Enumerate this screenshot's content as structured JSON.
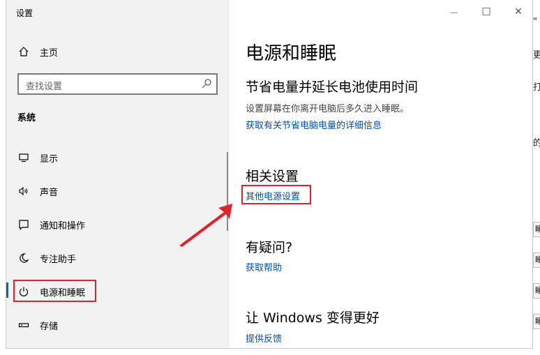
{
  "window": {
    "title": "设置"
  },
  "caption": {
    "minimize": "—",
    "maximize": "☐",
    "close": "✕"
  },
  "sidebar": {
    "home_label": "主页",
    "search_placeholder": "查找设置",
    "section_label": "系统",
    "items": [
      {
        "label": "显示",
        "icon": "monitor-icon"
      },
      {
        "label": "声音",
        "icon": "speaker-icon"
      },
      {
        "label": "通知和操作",
        "icon": "notification-icon"
      },
      {
        "label": "专注助手",
        "icon": "moon-icon"
      },
      {
        "label": "电源和睡眠",
        "icon": "power-icon",
        "selected": true
      },
      {
        "label": "存储",
        "icon": "storage-icon"
      }
    ]
  },
  "content": {
    "page_title": "电源和睡眠",
    "battery_section": {
      "heading": "节省电量并延长电池使用时间",
      "description": "设置屏幕在你离开电脑后多久进入睡眠。",
      "link": "获取有关节省电脑电量的详细信息"
    },
    "related_section": {
      "heading": "相关设置",
      "link": "其他电源设置"
    },
    "question_section": {
      "heading": "有疑问?",
      "link": "获取帮助"
    },
    "feedback_section": {
      "heading": "让 Windows 变得更好",
      "link": "提供反馈"
    }
  },
  "colors": {
    "accent": "#0067c0",
    "link": "#0050a0",
    "annotation": "#e0232b",
    "sidebar_bg": "#f2f2f2"
  }
}
